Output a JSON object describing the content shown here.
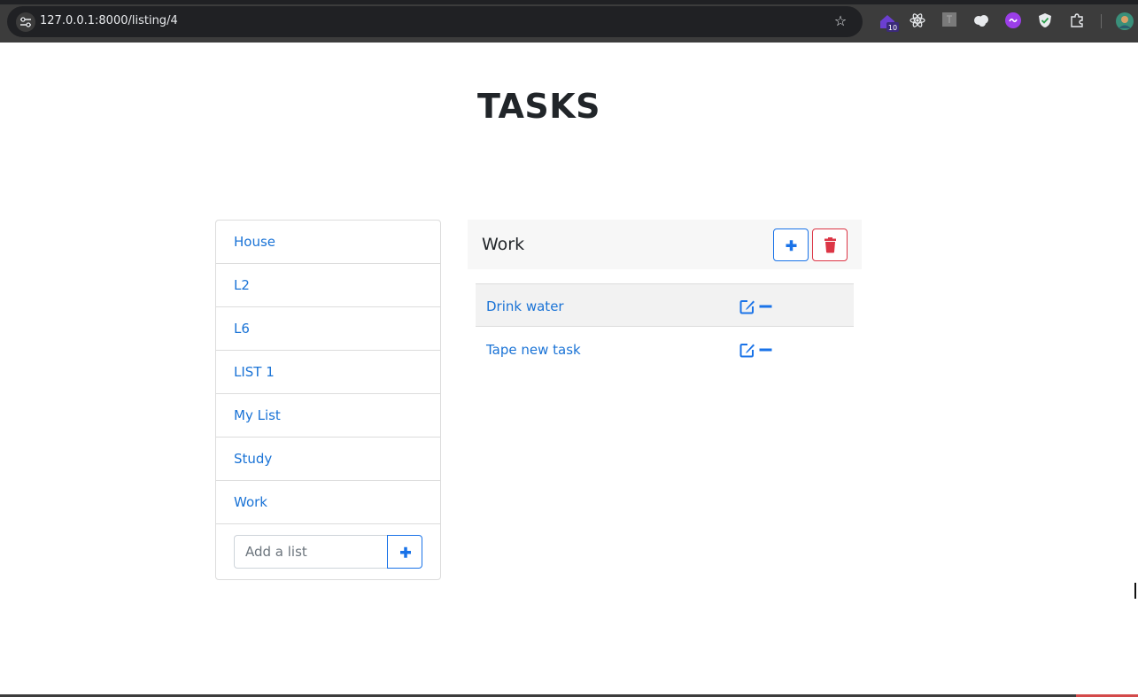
{
  "browser": {
    "url": "127.0.0.1:8000/listing/4",
    "extension_badge": "10",
    "icons": [
      "site-info-icon",
      "bookmark-star-icon",
      "extension-badge-icon",
      "react-icon",
      "extension-gray-icon",
      "extension-cloud-icon",
      "extension-purple-icon",
      "shield-check-icon",
      "puzzle-icon",
      "profile-avatar-icon"
    ]
  },
  "page": {
    "title": "TASKS"
  },
  "sidebar": {
    "items": [
      {
        "label": "House"
      },
      {
        "label": "L2"
      },
      {
        "label": "L6"
      },
      {
        "label": "LIST 1"
      },
      {
        "label": "My List"
      },
      {
        "label": "Study"
      },
      {
        "label": "Work"
      }
    ],
    "add_placeholder": "Add a list",
    "add_value": ""
  },
  "panel": {
    "title": "Work",
    "tasks": [
      {
        "label": "Drink water"
      },
      {
        "label": "Tape new task"
      }
    ]
  },
  "colors": {
    "primary": "#1a73e8",
    "danger": "#dc3545",
    "link": "#1a73d6"
  }
}
